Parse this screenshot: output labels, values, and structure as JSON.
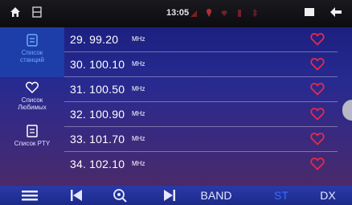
{
  "statusbar": {
    "time": "13:05",
    "left_icons": [
      "home-icon",
      "card-icon"
    ],
    "status_icons": [
      "signal-icon",
      "location-icon",
      "wifi-icon",
      "battery-icon",
      "bluetooth-icon"
    ],
    "right_icons": [
      "window-icon",
      "back-icon"
    ]
  },
  "sidebar": {
    "items": [
      {
        "label": "Список\nстанций",
        "icon": "list-icon",
        "active": true
      },
      {
        "label": "Список\nЛюбимых",
        "icon": "heart-outline-icon",
        "active": false
      },
      {
        "label": "Список PTY",
        "icon": "document-icon",
        "active": false
      }
    ]
  },
  "stations": [
    {
      "index": "29.",
      "freq": "99.20",
      "unit": "MHz",
      "favorite": true
    },
    {
      "index": "30.",
      "freq": "100.10",
      "unit": "MHz",
      "favorite": true
    },
    {
      "index": "31.",
      "freq": "100.50",
      "unit": "MHz",
      "favorite": true
    },
    {
      "index": "32.",
      "freq": "100.90",
      "unit": "MHz",
      "favorite": true
    },
    {
      "index": "33.",
      "freq": "101.70",
      "unit": "MHz",
      "favorite": true
    },
    {
      "index": "34.",
      "freq": "102.10",
      "unit": "MHz",
      "favorite": true
    }
  ],
  "bottombar": {
    "items": [
      {
        "icon": "menu-icon"
      },
      {
        "icon": "previous-icon"
      },
      {
        "icon": "scan-icon"
      },
      {
        "icon": "next-icon"
      },
      {
        "label": "BAND"
      },
      {
        "label": "ST"
      },
      {
        "label": "DX"
      }
    ]
  },
  "colors": {
    "heart": "#e8294a",
    "accent": "#3a6aff"
  }
}
